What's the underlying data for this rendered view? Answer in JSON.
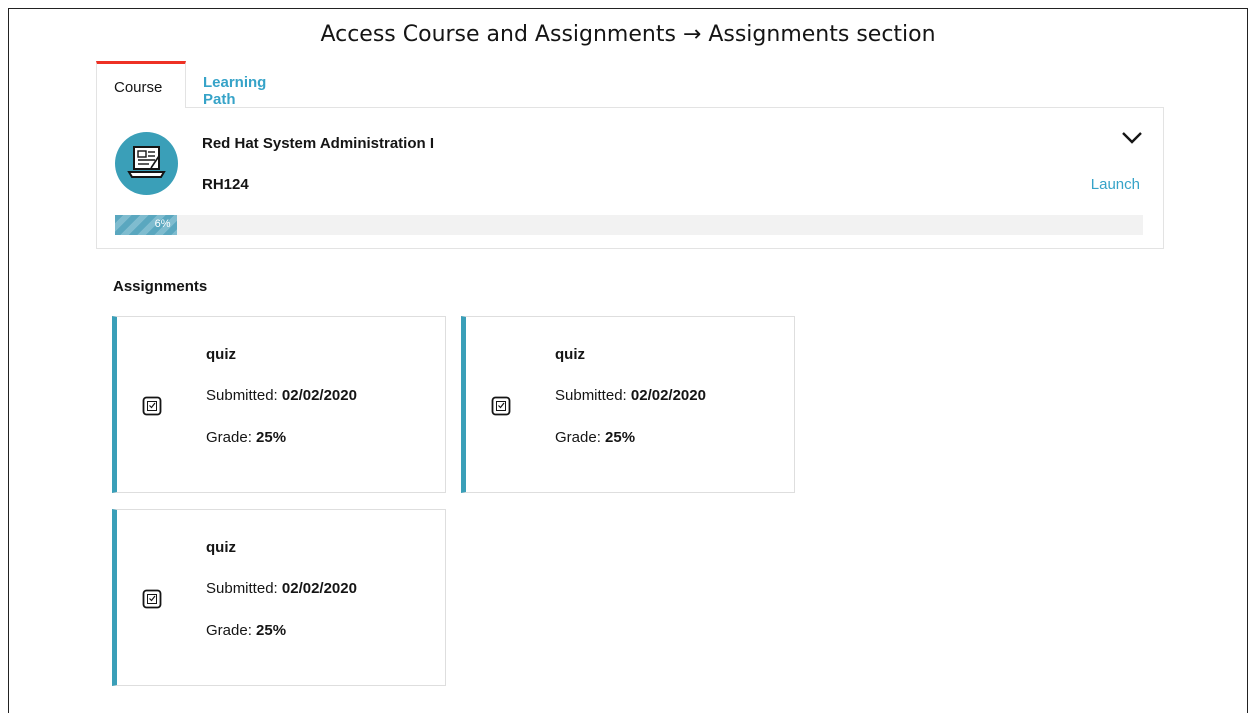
{
  "caption": "Access Course and Assignments → Assignments section",
  "tabs": [
    {
      "label": "Course",
      "active": true
    },
    {
      "label": "Learning Path",
      "active": false
    }
  ],
  "course": {
    "title": "Red Hat System Administration I",
    "code": "RH124",
    "launch_label": "Launch",
    "progress_percent": 6,
    "progress_label": "6%",
    "icon": "laptop-icon",
    "expand_icon": "chevron-down-icon"
  },
  "assignments": {
    "heading": "Assignments",
    "items": [
      {
        "name": "quiz",
        "submitted_label": "Submitted:",
        "submitted_date": "02/02/2020",
        "grade_label": "Grade:",
        "grade": "25%",
        "icon": "checkbox-icon"
      },
      {
        "name": "quiz",
        "submitted_label": "Submitted:",
        "submitted_date": "02/02/2020",
        "grade_label": "Grade:",
        "grade": "25%",
        "icon": "checkbox-icon"
      },
      {
        "name": "quiz",
        "submitted_label": "Submitted:",
        "submitted_date": "02/02/2020",
        "grade_label": "Grade:",
        "grade": "25%",
        "icon": "checkbox-icon"
      }
    ]
  },
  "colors": {
    "accent": "#36a3c8",
    "card_border": "#3a9fb8",
    "tab_active": "#ee3124"
  }
}
